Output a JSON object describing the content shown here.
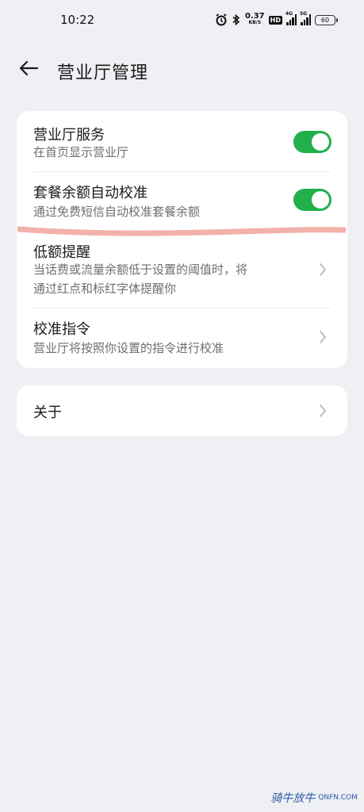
{
  "status_bar": {
    "time": "10:22",
    "speed_value": "0.37",
    "speed_unit": "KB/S",
    "hd_label": "HD",
    "signal_1_tag": "4G",
    "signal_2_tag": "5G",
    "battery_level": "60",
    "icons": [
      "alarm-icon",
      "bluetooth-icon",
      "hd-icon",
      "signal-icon",
      "signal-icon",
      "battery-icon"
    ]
  },
  "header": {
    "back_icon": "arrow-left-icon",
    "title": "营业厅管理"
  },
  "settings": {
    "items": [
      {
        "label": "营业厅服务",
        "description": "在首页显示营业厅",
        "control": "toggle",
        "state": "on"
      },
      {
        "label": "套餐余额自动校准",
        "description": "通过免费短信自动校准套餐余额",
        "control": "toggle",
        "state": "on"
      },
      {
        "label": "低额提醒",
        "description_line1": "当话费或流量余额低于设置的阈值时，将",
        "description_line2": "通过红点和标红字体提醒你",
        "control": "chevron"
      },
      {
        "label": "校准指令",
        "description": "营业厅将按照你设置的指令进行校准",
        "control": "chevron"
      }
    ]
  },
  "about": {
    "label": "关于",
    "control": "chevron"
  },
  "watermark": {
    "text": "骑牛放牛",
    "site": "QNFN.COM"
  },
  "colors": {
    "background": "#eff0f4",
    "card": "#ffffff",
    "toggle_on": "#21b04b",
    "annotation_stroke": "#f0a39a",
    "chevron": "#b8b8b8"
  }
}
